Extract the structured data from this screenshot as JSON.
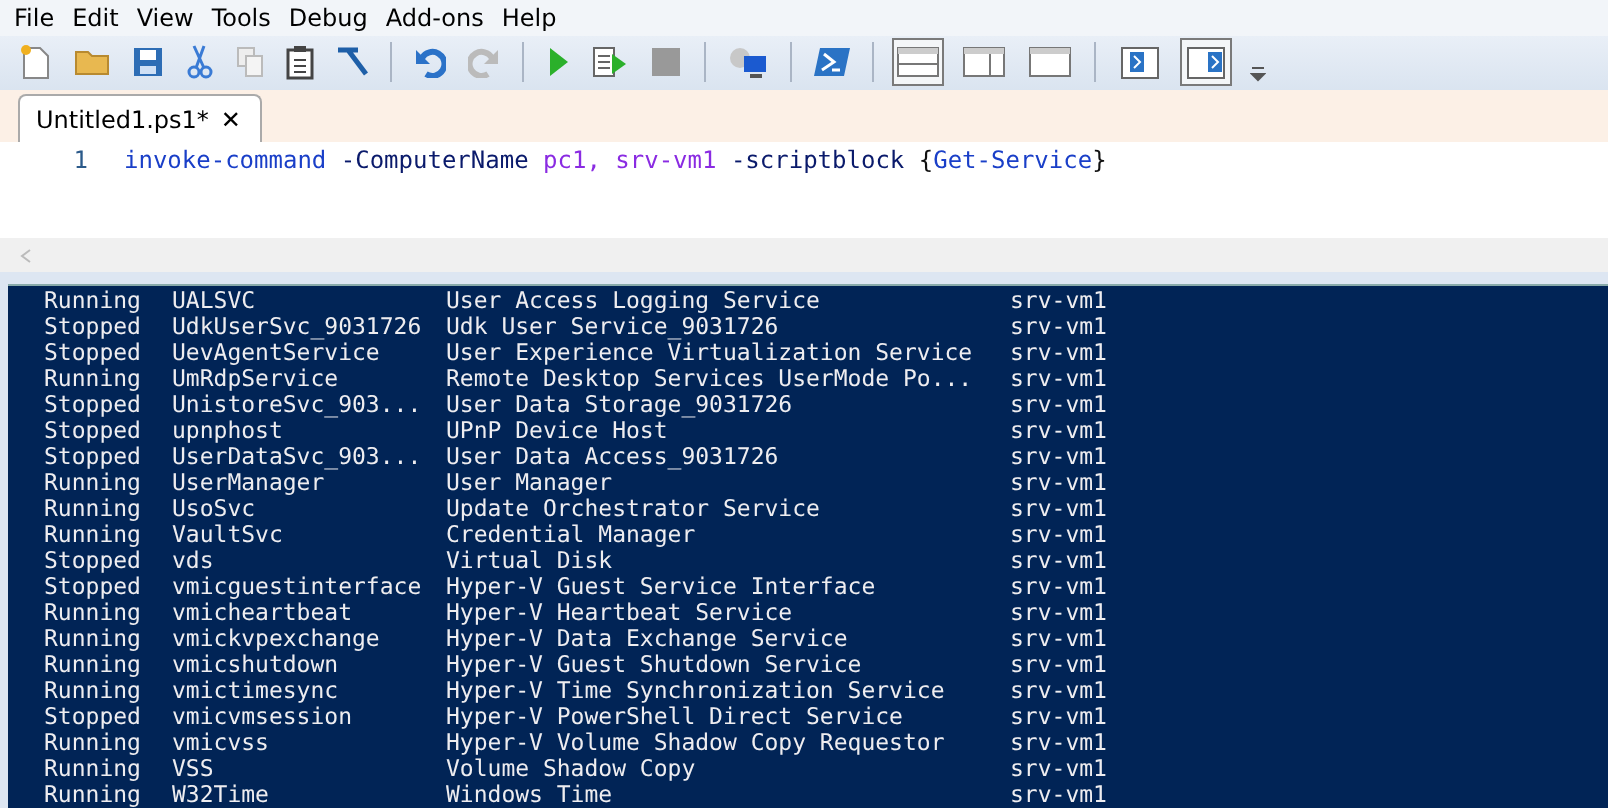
{
  "menu": [
    "File",
    "Edit",
    "View",
    "Tools",
    "Debug",
    "Add-ons",
    "Help"
  ],
  "pane_layouts": [
    {
      "selected": true
    },
    {
      "selected": false
    },
    {
      "selected": false
    }
  ],
  "addon_toggles": [
    {
      "selected": false
    },
    {
      "selected": true
    }
  ],
  "tabs": [
    {
      "label": "Untitled1.ps1*",
      "selected": true,
      "close": "✕"
    }
  ],
  "editor": {
    "lines": [
      {
        "number": "1",
        "tokens": [
          {
            "kind": "command",
            "text": "invoke-command "
          },
          {
            "kind": "parameter",
            "text": "-ComputerName "
          },
          {
            "kind": "argument",
            "text": "pc1, "
          },
          {
            "kind": "argument",
            "text": "srv-vm1 "
          },
          {
            "kind": "parameter",
            "text": "-scriptblock "
          },
          {
            "kind": "brace",
            "text": "{"
          },
          {
            "kind": "command",
            "text": "Get-Service"
          },
          {
            "kind": "brace",
            "text": "}"
          }
        ]
      }
    ]
  },
  "console": {
    "rows": [
      [
        "Running",
        "UALSVC",
        "User Access Logging Service",
        "srv-vm1"
      ],
      [
        "Stopped",
        "UdkUserSvc_9031726",
        "Udk User Service_9031726",
        "srv-vm1"
      ],
      [
        "Stopped",
        "UevAgentService",
        "User Experience Virtualization Service",
        "srv-vm1"
      ],
      [
        "Running",
        "UmRdpService",
        "Remote Desktop Services UserMode Po...",
        "srv-vm1"
      ],
      [
        "Stopped",
        "UnistoreSvc_903...",
        "User Data Storage_9031726",
        "srv-vm1"
      ],
      [
        "Stopped",
        "upnphost",
        "UPnP Device Host",
        "srv-vm1"
      ],
      [
        "Stopped",
        "UserDataSvc_903...",
        "User Data Access_9031726",
        "srv-vm1"
      ],
      [
        "Running",
        "UserManager",
        "User Manager",
        "srv-vm1"
      ],
      [
        "Running",
        "UsoSvc",
        "Update Orchestrator Service",
        "srv-vm1"
      ],
      [
        "Running",
        "VaultSvc",
        "Credential Manager",
        "srv-vm1"
      ],
      [
        "Stopped",
        "vds",
        "Virtual Disk",
        "srv-vm1"
      ],
      [
        "Stopped",
        "vmicguestinterface",
        "Hyper-V Guest Service Interface",
        "srv-vm1"
      ],
      [
        "Running",
        "vmicheartbeat",
        "Hyper-V Heartbeat Service",
        "srv-vm1"
      ],
      [
        "Running",
        "vmickvpexchange",
        "Hyper-V Data Exchange Service",
        "srv-vm1"
      ],
      [
        "Running",
        "vmicshutdown",
        "Hyper-V Guest Shutdown Service",
        "srv-vm1"
      ],
      [
        "Running",
        "vmictimesync",
        "Hyper-V Time Synchronization Service",
        "srv-vm1"
      ],
      [
        "Stopped",
        "vmicvmsession",
        "Hyper-V PowerShell Direct Service",
        "srv-vm1"
      ],
      [
        "Running",
        "vmicvss",
        "Hyper-V Volume Shadow Copy Requestor",
        "srv-vm1"
      ],
      [
        "Running",
        "VSS",
        "Volume Shadow Copy",
        "srv-vm1"
      ],
      [
        "Running",
        "W32Time",
        "Windows Time",
        "srv-vm1"
      ]
    ]
  }
}
